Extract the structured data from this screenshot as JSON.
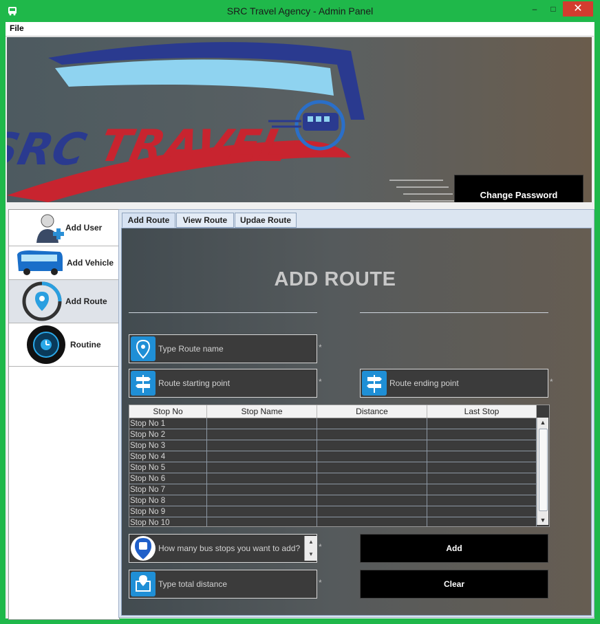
{
  "window": {
    "title": "SRC Travel Agency - Admin Panel",
    "minimize": "‒",
    "maximize": "□",
    "close": "✕"
  },
  "menu": {
    "file": "File"
  },
  "banner": {
    "logo_text": "SRC TRAVEL",
    "change_password": "Change Password"
  },
  "sidebar": {
    "items": [
      {
        "label": "Add User",
        "icon": "add-user-icon"
      },
      {
        "label": "Add Vehicle",
        "icon": "bus-icon"
      },
      {
        "label": "Add Route",
        "icon": "route-pin-icon"
      },
      {
        "label": "Routine",
        "icon": "clock-icon"
      }
    ],
    "active_index": 2
  },
  "tabs": [
    {
      "label": "Add Route"
    },
    {
      "label": "View Route"
    },
    {
      "label": "Updae Route"
    }
  ],
  "form": {
    "heading": "ADD ROUTE",
    "route_name_placeholder": "Type Route name",
    "start_placeholder": "Route starting point",
    "end_placeholder": "Route ending point",
    "stops_placeholder": "How many bus stops you want to add?",
    "distance_placeholder": "Type total distance",
    "required_mark": "*",
    "add_button": "Add",
    "clear_button": "Clear"
  },
  "table": {
    "columns": [
      "Stop No",
      "Stop Name",
      "Distance",
      "Last Stop"
    ],
    "rows": [
      "Stop No 1",
      "Stop No 2",
      "Stop No 3",
      "Stop No 4",
      "Stop No 5",
      "Stop No 6",
      "Stop No 7",
      "Stop No 8",
      "Stop No 9",
      "Stop No 10"
    ]
  },
  "colors": {
    "window_frame": "#1fb84a",
    "accent_icon": "#1f8fd6",
    "close": "#d33c2f",
    "logo_blue": "#2a3a8f",
    "logo_red": "#c8242f",
    "logo_sky": "#8fd3f0"
  }
}
